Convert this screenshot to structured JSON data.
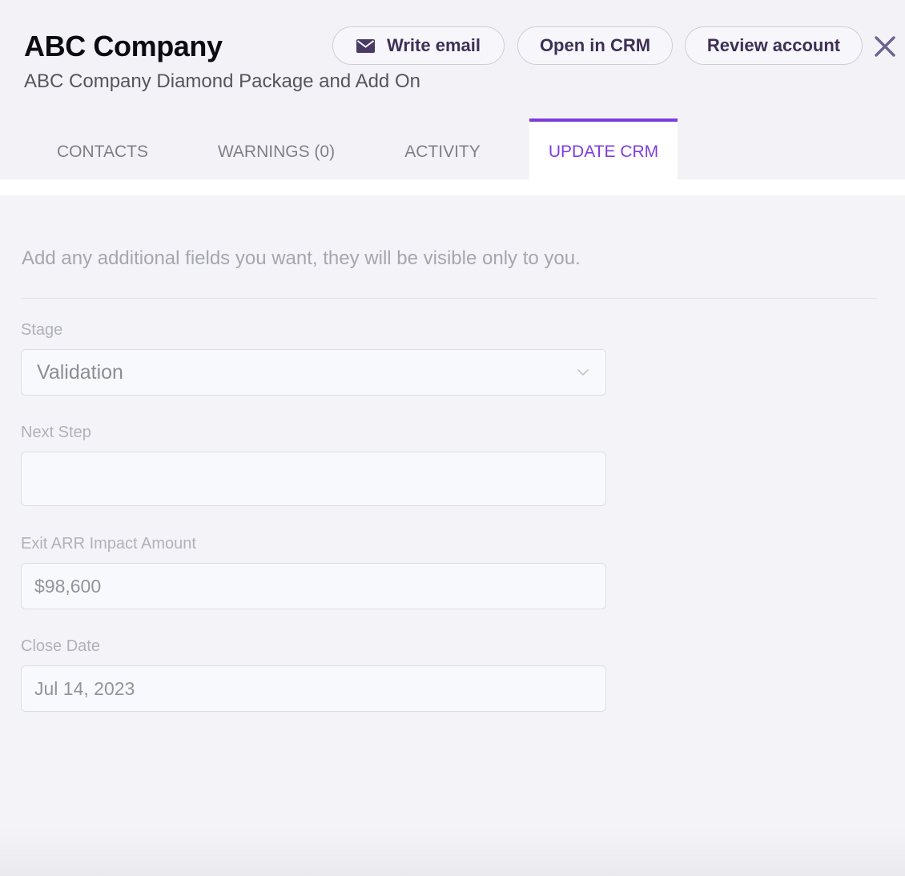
{
  "header": {
    "title": "ABC Company",
    "subtitle": "ABC Company Diamond Package and Add On"
  },
  "actions": {
    "write_email": "Write email",
    "open_crm": "Open in CRM",
    "review_account": "Review account"
  },
  "tabs": [
    {
      "label": "CONTACTS",
      "active": false
    },
    {
      "label": "WARNINGS (0)",
      "active": false
    },
    {
      "label": "ACTIVITY",
      "active": false
    },
    {
      "label": "UPDATE CRM",
      "active": true
    }
  ],
  "form": {
    "intro": "Add any additional fields you want, they will be visible only to you.",
    "stage": {
      "label": "Stage",
      "value": "Validation"
    },
    "next_step": {
      "label": "Next Step",
      "value": ""
    },
    "exit_arr": {
      "label": "Exit ARR Impact Amount",
      "value": "$98,600"
    },
    "close_date": {
      "label": "Close Date",
      "value": "Jul 14, 2023"
    }
  },
  "icons": {
    "email": "mail-icon",
    "close": "close-icon",
    "dropdown": "chevron-down-icon"
  },
  "colors": {
    "accent": "#7c3ae0",
    "button_text": "#3e2f57",
    "close_icon": "#6e6390"
  }
}
